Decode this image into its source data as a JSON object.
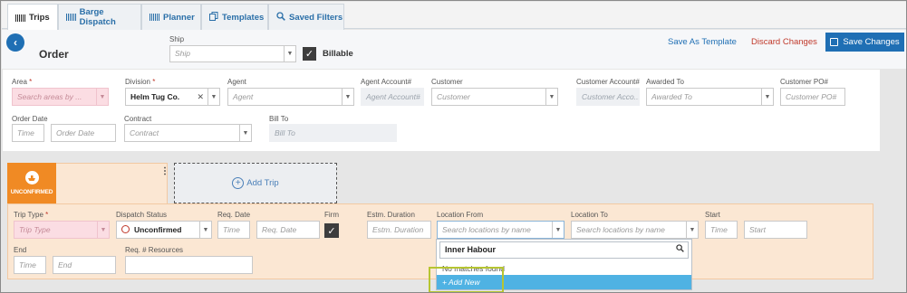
{
  "tabs": [
    {
      "label": "Trips",
      "icon": "barcode-icon",
      "active": true
    },
    {
      "label": "Barge Dispatch",
      "icon": "barcode-icon",
      "active": false
    },
    {
      "label": "Planner",
      "icon": "barcode-icon",
      "active": false
    },
    {
      "label": "Templates",
      "icon": "copy-icon",
      "active": false
    },
    {
      "label": "Saved Filters",
      "icon": "search-icon",
      "active": false
    }
  ],
  "header": {
    "title": "Order",
    "ship_label": "Ship",
    "ship_placeholder": "Ship",
    "billable_label": "Billable",
    "save_as_template": "Save As Template",
    "discard_changes": "Discard Changes",
    "save_changes": "Save Changes"
  },
  "order": {
    "area": {
      "label": "Area",
      "required": "*",
      "placeholder": "Search areas by ..."
    },
    "division": {
      "label": "Division",
      "required": "*",
      "value": "Helm Tug Co."
    },
    "agent": {
      "label": "Agent",
      "placeholder": "Agent"
    },
    "agent_account": {
      "label": "Agent Account#",
      "placeholder": "Agent Account#"
    },
    "customer": {
      "label": "Customer",
      "placeholder": "Customer"
    },
    "customer_account": {
      "label": "Customer Account#",
      "placeholder": "Customer Acco..."
    },
    "awarded_to": {
      "label": "Awarded To",
      "placeholder": "Awarded To"
    },
    "customer_po": {
      "label": "Customer PO#",
      "placeholder": "Customer PO#"
    },
    "order_date": {
      "label": "Order Date",
      "time_placeholder": "Time",
      "date_placeholder": "Order Date"
    },
    "contract": {
      "label": "Contract",
      "placeholder": "Contract"
    },
    "bill_to": {
      "label": "Bill To",
      "placeholder": "Bill To"
    }
  },
  "trip_card": {
    "status": "UNCONFIRMED",
    "add_trip": "Add Trip"
  },
  "trip": {
    "trip_type": {
      "label": "Trip Type",
      "required": "*",
      "placeholder": "Trip Type"
    },
    "dispatch_status": {
      "label": "Dispatch Status",
      "value": "Unconfirmed"
    },
    "req_date": {
      "label": "Req. Date",
      "time_placeholder": "Time",
      "date_placeholder": "Req. Date"
    },
    "firm": {
      "label": "Firm"
    },
    "estm_duration": {
      "label": "Estm. Duration",
      "placeholder": "Estm. Duration"
    },
    "location_from": {
      "label": "Location From",
      "placeholder": "Search locations by name"
    },
    "location_to": {
      "label": "Location To",
      "placeholder": "Search locations by name"
    },
    "start": {
      "label": "Start",
      "time_placeholder": "Time",
      "date_placeholder": "Start"
    },
    "end": {
      "label": "End",
      "time_placeholder": "Time",
      "date_placeholder": "End"
    },
    "req_resources": {
      "label": "Req. # Resources"
    }
  },
  "location_dropdown": {
    "search_value": "Inner Habour",
    "no_matches": "No matches found",
    "add_new": "+ Add New"
  },
  "colors": {
    "accent": "#1f6fb4",
    "discard": "#c0392b",
    "status_orange": "#f08a24",
    "required_pink": "#fbdde3",
    "add_new_blue": "#4fb2e3",
    "highlight": "#b6c531"
  }
}
